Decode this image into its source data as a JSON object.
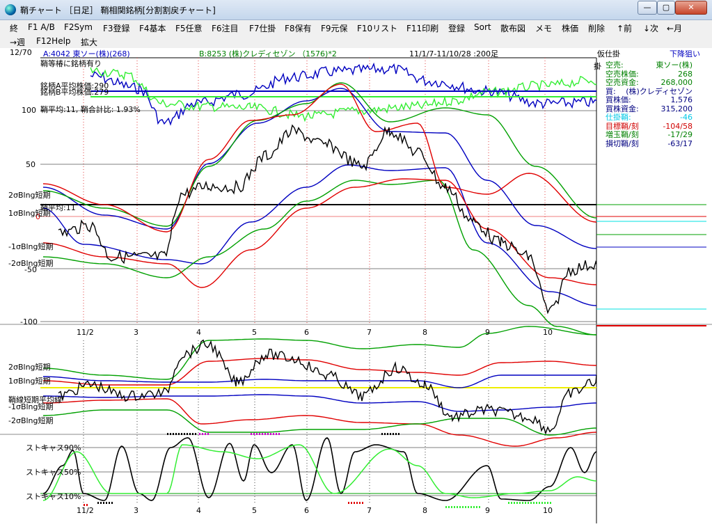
{
  "window": {
    "title": "鞘チャート ［日足］ 鞘相関銘柄[分割割戻チャート]",
    "min_label": "—",
    "max_label": "▢",
    "close_label": "✕"
  },
  "menu": {
    "row1": [
      "終",
      "F1 A/B",
      "F2Sym",
      "F3登録",
      "F4基本",
      "F5任意",
      "F6注目",
      "F7仕掛",
      "F8保有",
      "F9元保",
      "F10リスト",
      "F11印刷",
      "登録",
      "Sort",
      "散布図",
      "メモ",
      "株価",
      "削除",
      "↑前",
      "↓次",
      "←月"
    ],
    "row2": [
      "→週",
      "F12Help",
      "拡大"
    ]
  },
  "header": {
    "count": "12/70",
    "stock_a": "A:4042 東ソー(株)(268)",
    "stock_b": "B:8253 (株)クレディセゾン （1576)*2",
    "period": "11/1/7-11/10/28 :200足",
    "status_left": "仮仕掛",
    "status_right": "下降狙い"
  },
  "notes": {
    "line1": "鞘等椿に銘柄有り",
    "line2": "銘柄A平均株価:290",
    "line3": "銘柄B平均株価:279",
    "line4": "鞘平均:11, 鞘合計比: 1.93%",
    "hang": "掛"
  },
  "upper_axis": [
    "100",
    "50",
    "0",
    "-50",
    "-100"
  ],
  "upper_labels": [
    "2σBlng短期",
    "鞘平均:11",
    "1σBlng短期",
    "-1σBlng短期",
    "-2σBlng短期"
  ],
  "middle_labels": [
    "2σBlng短期",
    "1σBlng短期",
    "鞘線短期平均線",
    "-1σBlng短期",
    "-2σBlng短期"
  ],
  "stoch_labels": [
    "ストキャス90%",
    "ストキャス50%",
    "ストキャス10%"
  ],
  "x_dates": [
    "11/2",
    "3",
    "4",
    "5",
    "6",
    "7",
    "8",
    "9",
    "10"
  ],
  "side_panel": [
    {
      "label": "空売:",
      "value": "東ソー(株)",
      "color": "#008000"
    },
    {
      "label": "空売株価:",
      "value": "268",
      "color": "#008000"
    },
    {
      "label": "空売資金:",
      "value": "268,000",
      "color": "#008000"
    },
    {
      "label": "買:",
      "value": "(株)クレディセゾン",
      "color": "#000080"
    },
    {
      "label": "買株価:",
      "value": "1,576",
      "color": "#000080"
    },
    {
      "label": "買株資金:",
      "value": "315,200",
      "color": "#000080"
    },
    {
      "label": "仕掛鞘:",
      "value": "-46",
      "color": "#00c8e6"
    },
    {
      "label": "目標鞘/刻",
      "value": "-104/58",
      "color": "#d00000"
    },
    {
      "label": "増玉鞘/刻",
      "value": "-17/29",
      "color": "#008000"
    },
    {
      "label": "損切鞘/刻",
      "value": "-63/17",
      "color": "#000080"
    }
  ],
  "colors": {
    "red": "#e00000",
    "green": "#00a000",
    "blue": "#0000c0",
    "lime": "#33ee33",
    "yellow": "#eeee00",
    "cyan": "#00e0e0"
  }
}
